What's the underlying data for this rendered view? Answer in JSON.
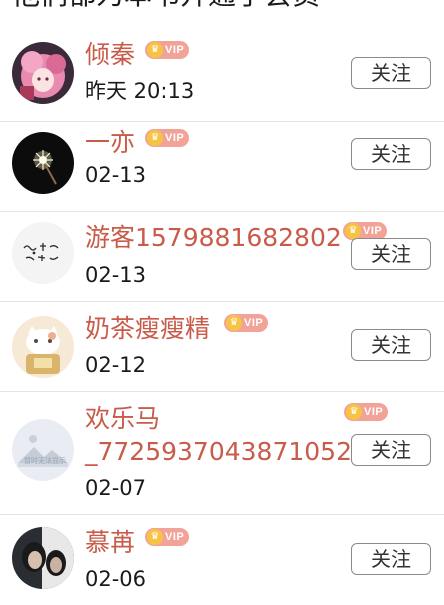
{
  "header": {
    "title": "他们都为本书开通了会员"
  },
  "vip_label": "VIP",
  "colors": {
    "name": "#c95b4a",
    "vip_badge": "#f2a398",
    "vip_crown": "#f6c343",
    "divider": "#e4e4e4"
  },
  "members": [
    {
      "name": "倾秦",
      "date": "昨天 20:13",
      "follow_label": "关注",
      "avatar_icon": "anime-girl-pink-avatar"
    },
    {
      "name": "一亦",
      "date": "02-13",
      "follow_label": "关注",
      "avatar_icon": "sparkler-avatar"
    },
    {
      "name": "游客1579881682802",
      "date": "02-13",
      "follow_label": "关注",
      "avatar_icon": "handwriting-avatar"
    },
    {
      "name": "奶茶瘦瘦精",
      "date": "02-12",
      "follow_label": "关注",
      "avatar_icon": "cat-cartoon-avatar"
    },
    {
      "name_line1": "欢乐马",
      "name_line2": "_7725937043871052",
      "date": "02-07",
      "follow_label": "关注",
      "avatar_icon": "default-mountain-avatar",
      "avatar_caption": "暂时无法显示"
    },
    {
      "name": "慕苒",
      "date": "02-06",
      "follow_label": "关注",
      "avatar_icon": "portrait-photo-avatar"
    }
  ]
}
